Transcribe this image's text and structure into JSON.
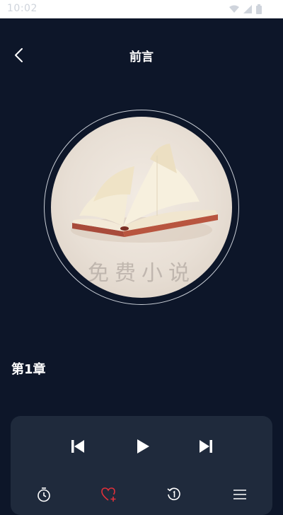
{
  "status_bar": {
    "time": "10:02"
  },
  "header": {
    "title": "前言",
    "back_icon": "back-chevron-icon"
  },
  "cover": {
    "watermark": "免费小说"
  },
  "chapter": {
    "title": "第1章"
  },
  "player": {
    "controls": [
      "previous-icon",
      "play-icon",
      "next-icon"
    ],
    "bottom_actions": [
      "timer-icon",
      "favorite-add-icon",
      "replay-icon",
      "playlist-icon"
    ],
    "favorite_color": "#e0303a"
  },
  "colors": {
    "background": "#0d1629",
    "panel": "#1f2a3c"
  }
}
